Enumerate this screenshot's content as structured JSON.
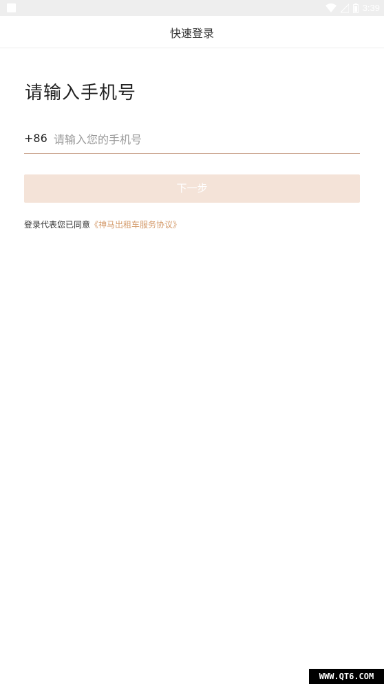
{
  "status_bar": {
    "time": "3:39",
    "icons": [
      "notification-icon",
      "wifi-icon",
      "signal-icon",
      "battery-icon"
    ]
  },
  "nav": {
    "title": "快速登录"
  },
  "login": {
    "heading": "请输入手机号",
    "country_code": "+86",
    "phone_placeholder": "请输入您的手机号",
    "phone_value": "",
    "next_label": "下一步",
    "agreement_prefix": "登录代表您已同意",
    "agreement_link": "《神马出租车服务协议》"
  },
  "watermark": "WWW.QT6.COM",
  "colors": {
    "accent": "#d49a6a",
    "button_disabled_bg": "#f4e3d8",
    "underline": "#c8a28b"
  }
}
